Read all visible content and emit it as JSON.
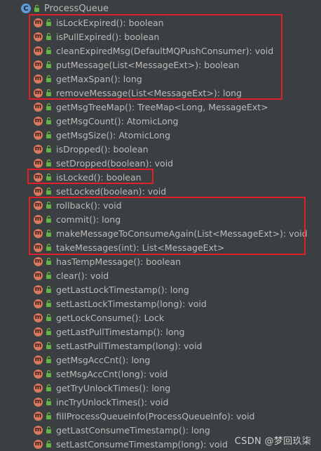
{
  "tree": {
    "class_name": "ProcessQueue",
    "class_icon_letter": "C",
    "method_icon_letter": "m",
    "members": [
      "isLockExpired(): boolean",
      "isPullExpired(): boolean",
      "cleanExpiredMsg(DefaultMQPushConsumer): void",
      "putMessage(List<MessageExt>): boolean",
      "getMaxSpan(): long",
      "removeMessage(List<MessageExt>): long",
      "getMsgTreeMap(): TreeMap<Long, MessageExt>",
      "getMsgCount(): AtomicLong",
      "getMsgSize(): AtomicLong",
      "isDropped(): boolean",
      "setDropped(boolean): void",
      "isLocked(): boolean",
      "setLocked(boolean): void",
      "rollback(): void",
      "commit(): long",
      "makeMessageToConsumeAgain(List<MessageExt>): void",
      "takeMessages(int): List<MessageExt>",
      "hasTempMessage(): boolean",
      "clear(): void",
      "getLastLockTimestamp(): long",
      "setLastLockTimestamp(long): void",
      "getLockConsume(): Lock",
      "getLastPullTimestamp(): long",
      "setLastPullTimestamp(long): void",
      "getMsgAccCnt(): long",
      "setMsgAccCnt(long): void",
      "getTryUnlockTimes(): long",
      "incTryUnlockTimes(): void",
      "fillProcessQueueInfo(ProcessQueueInfo): void",
      "getLastConsumeTimestamp(): long",
      "setLastConsumeTimestamp(long): void"
    ]
  },
  "watermark": "CSDN @梦回玖柒",
  "colors": {
    "background": "#3c3f41",
    "text": "#bbbbbb",
    "class_icon": "#5e9bd6",
    "method_icon": "#d9785f",
    "lock_icon": "#62b543",
    "highlight_box": "#e0202a"
  },
  "icons": {
    "class": "class-icon",
    "method": "method-icon",
    "visibility": "public-lock-icon"
  }
}
